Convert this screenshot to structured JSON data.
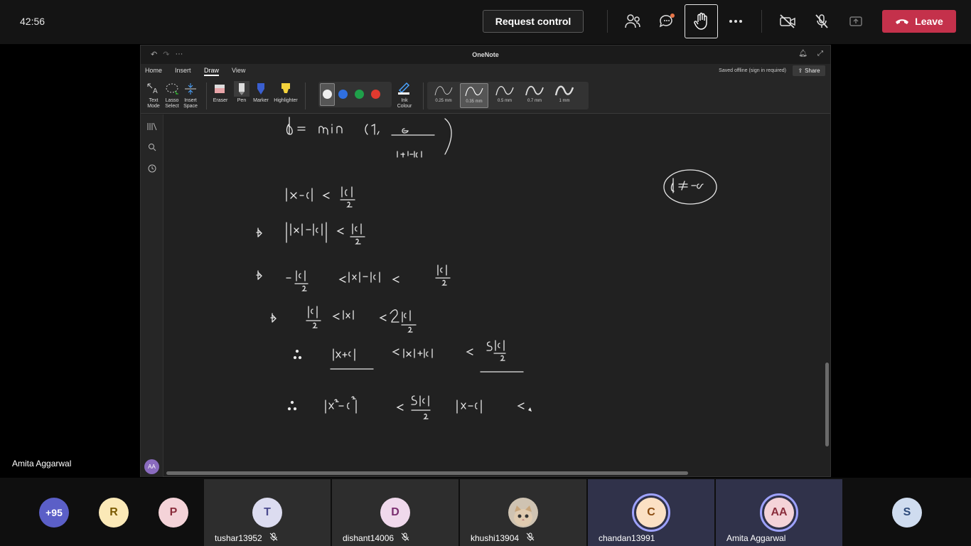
{
  "topbar": {
    "timer": "42:56",
    "request_control": "Request control",
    "leave": "Leave",
    "icons": [
      "people-icon",
      "chat-icon",
      "raise-hand-icon",
      "more-icon",
      "camera-off-icon",
      "mic-off-icon",
      "share-tray-icon",
      "phone-icon"
    ]
  },
  "presenter": {
    "name": "Amita Aggarwal"
  },
  "onenote": {
    "title": "OneNote",
    "menu": [
      "Home",
      "Insert",
      "Draw",
      "View"
    ],
    "active_menu": "Draw",
    "saved_status": "Saved offline (sign in required)",
    "share_label": "Share",
    "tools": {
      "text_mode": "Text Mode",
      "lasso_select": "Lasso Select",
      "insert_space": "Insert Space",
      "eraser": "Eraser",
      "pen": "Pen",
      "marker": "Marker",
      "highlighter": "Highlighter",
      "ink_colour": "Ink Colour"
    },
    "colors": [
      "#f0f0f0",
      "#2f6fe0",
      "#1fa04a",
      "#e03a2f"
    ],
    "thickness": [
      "0.25 mm",
      "0.35 mm",
      "0.5 mm",
      "0.7 mm",
      "1 mm"
    ],
    "selected_thickness": "0.35 mm",
    "user_initials": "AA"
  },
  "participants": {
    "overflow": "+95",
    "avatars": [
      {
        "initial": "R",
        "color": "#fbe9b7",
        "text": "#7a5a00"
      },
      {
        "initial": "P",
        "color": "#f4d3d8",
        "text": "#8a2d3c"
      }
    ],
    "tiles": [
      {
        "name": "tushar13952",
        "initial": "T",
        "color": "#dcdcf0",
        "text": "#4b4b8f",
        "muted": true,
        "active": false
      },
      {
        "name": "dishant14006",
        "initial": "D",
        "color": "#f0d9ec",
        "text": "#7a2d6f",
        "muted": true,
        "active": false
      },
      {
        "name": "khushi13904",
        "initial": "",
        "color": "#c9b9a4",
        "text": "#333",
        "muted": true,
        "active": false
      },
      {
        "name": "chandan13991",
        "initial": "C",
        "color": "#fbe0c4",
        "text": "#8a4a10",
        "muted": false,
        "active": true
      },
      {
        "name": "Amita Aggarwal",
        "initial": "AA",
        "color": "#f4d3d8",
        "text": "#8a2d3c",
        "muted": false,
        "active": true
      }
    ],
    "last": {
      "initial": "S",
      "color": "#cfdcef",
      "text": "#2d4a7a"
    }
  }
}
